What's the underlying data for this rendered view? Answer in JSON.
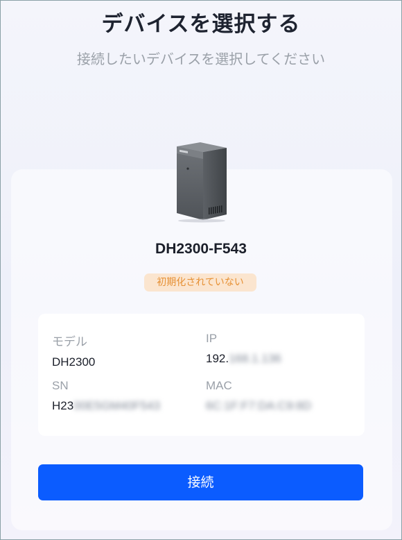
{
  "header": {
    "title": "デバイスを選択する",
    "subtitle": "接続したいデバイスを選択してください"
  },
  "device": {
    "image_icon": "nas-device-icon",
    "name": "DH2300-F543",
    "status_badge": "初期化されていない",
    "details": {
      "model_label": "モデル",
      "model_value": "DH2300",
      "ip_label": "IP",
      "ip_visible": "192.",
      "ip_masked": "168.1.136",
      "sn_label": "SN",
      "sn_visible": "H23",
      "sn_masked": "00E5GM40F543",
      "mac_label": "MAC",
      "mac_masked": "6C:1F:F7:DA:C9:8D"
    }
  },
  "actions": {
    "connect_label": "接続"
  },
  "colors": {
    "accent": "#0b5cff",
    "badge_bg": "#fbe5cf",
    "badge_text": "#e69034"
  }
}
